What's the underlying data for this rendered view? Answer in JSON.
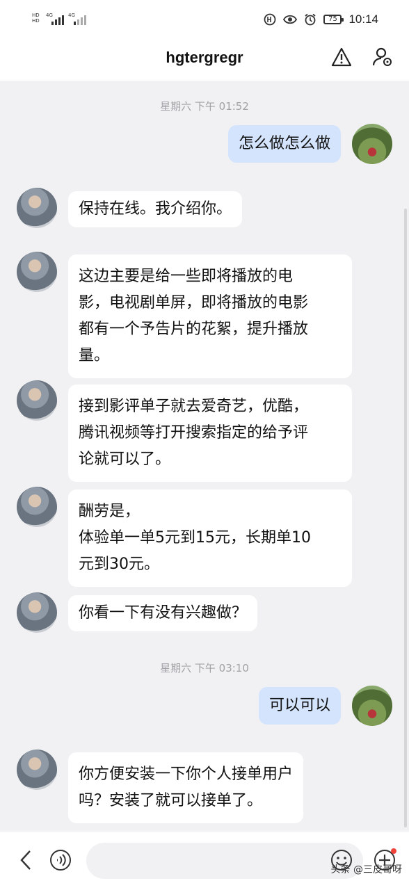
{
  "status_bar": {
    "sim1_label_top": "HD",
    "sim1_label_bottom": "HD",
    "network1": "4G",
    "network2": "4G",
    "battery": "75",
    "time": "10:14"
  },
  "header": {
    "title": "hgtergregr",
    "report_icon": "warning-triangle-icon",
    "profile_icon": "user-settings-icon"
  },
  "chat": {
    "timestamps": [
      "星期六 下午 01:52",
      "星期六 下午 03:10"
    ],
    "messages": [
      {
        "side": "out",
        "text": "怎么做怎么做"
      },
      {
        "side": "in",
        "text": "保持在线。我介绍你。"
      },
      {
        "side": "in",
        "text": "这边主要是给一些即将播放的电\n影，电视剧单屏，即将播放的电影\n都有一个予告片的花絮，提升播放\n量。"
      },
      {
        "side": "in",
        "text": "接到影评单子就去爱奇艺，优酷，\n腾讯视频等打开搜索指定的给予评\n论就可以了。"
      },
      {
        "side": "in",
        "text": "酬劳是，\n体验单一单5元到15元，长期单10\n元到30元。"
      },
      {
        "side": "in",
        "text": "你看一下有没有兴趣做？"
      },
      {
        "side": "out",
        "text": "可以可以"
      },
      {
        "side": "in",
        "text": "你方便安装一下你个人接单用户\n吗？安装了就可以接单了。"
      }
    ]
  },
  "bottom_bar": {
    "back_icon": "chevron-left-icon",
    "voice_icon": "voice-icon",
    "input_value": "",
    "emoji_icon": "emoji-icon",
    "plus_icon": "plus-circle-icon",
    "watermark": "头条 @三皮哥呀"
  },
  "colors": {
    "background": "#f1f1f3",
    "incoming_bubble": "#ffffff",
    "outgoing_bubble": "#d4e4fd",
    "timestamp": "#a2a2a6",
    "notification_dot": "#f0433a"
  }
}
